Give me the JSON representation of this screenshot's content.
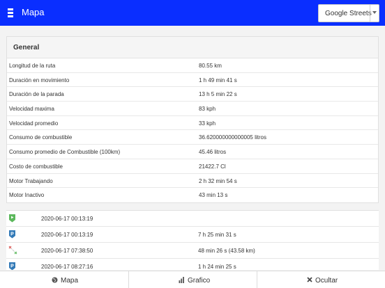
{
  "header": {
    "title": "Mapa",
    "map_type": "Google Streets"
  },
  "general": {
    "title": "General",
    "rows": [
      {
        "label": "Longitud de la ruta",
        "value": "80.55 km"
      },
      {
        "label": "Duración en movimiento",
        "value": "1 h 49 min 41 s"
      },
      {
        "label": "Duración de la parada",
        "value": "13 h 5 min 22 s"
      },
      {
        "label": "Velocidad maxima",
        "value": "83 kph"
      },
      {
        "label": "Velocidad promedio",
        "value": "33 kph"
      },
      {
        "label": "Consumo de combustible",
        "value": "36.620000000000005 litros"
      },
      {
        "label": "Consumo promedio de Combustible (100km)",
        "value": "45.46 litros"
      },
      {
        "label": "Costo de combustible",
        "value": "21422.7 Cl"
      },
      {
        "label": "Motor Trabajando",
        "value": "2 h 32 min 54 s"
      },
      {
        "label": "Motor Inactivo",
        "value": "43 min 13 s"
      }
    ]
  },
  "events": [
    {
      "icon": "route-start-icon",
      "datetime": "2020-06-17 00:13:19",
      "duration": ""
    },
    {
      "icon": "parking-icon",
      "datetime": "2020-06-17 00:13:19",
      "duration": "7 h 25 min 31 s"
    },
    {
      "icon": "gps-gap-icon",
      "datetime": "2020-06-17 07:38:50",
      "duration": "48 min 26 s (43.58 km)"
    },
    {
      "icon": "parking-icon",
      "datetime": "2020-06-17 08:27:16",
      "duration": "1 h 24 min 25 s"
    }
  ],
  "bottom_bar": {
    "map_label": "Mapa",
    "chart_label": "Grafico",
    "hide_label": "Ocultar"
  },
  "colors": {
    "topbar": "#0a2eff",
    "start": "#5cb85c",
    "parking": "#337ab7"
  }
}
